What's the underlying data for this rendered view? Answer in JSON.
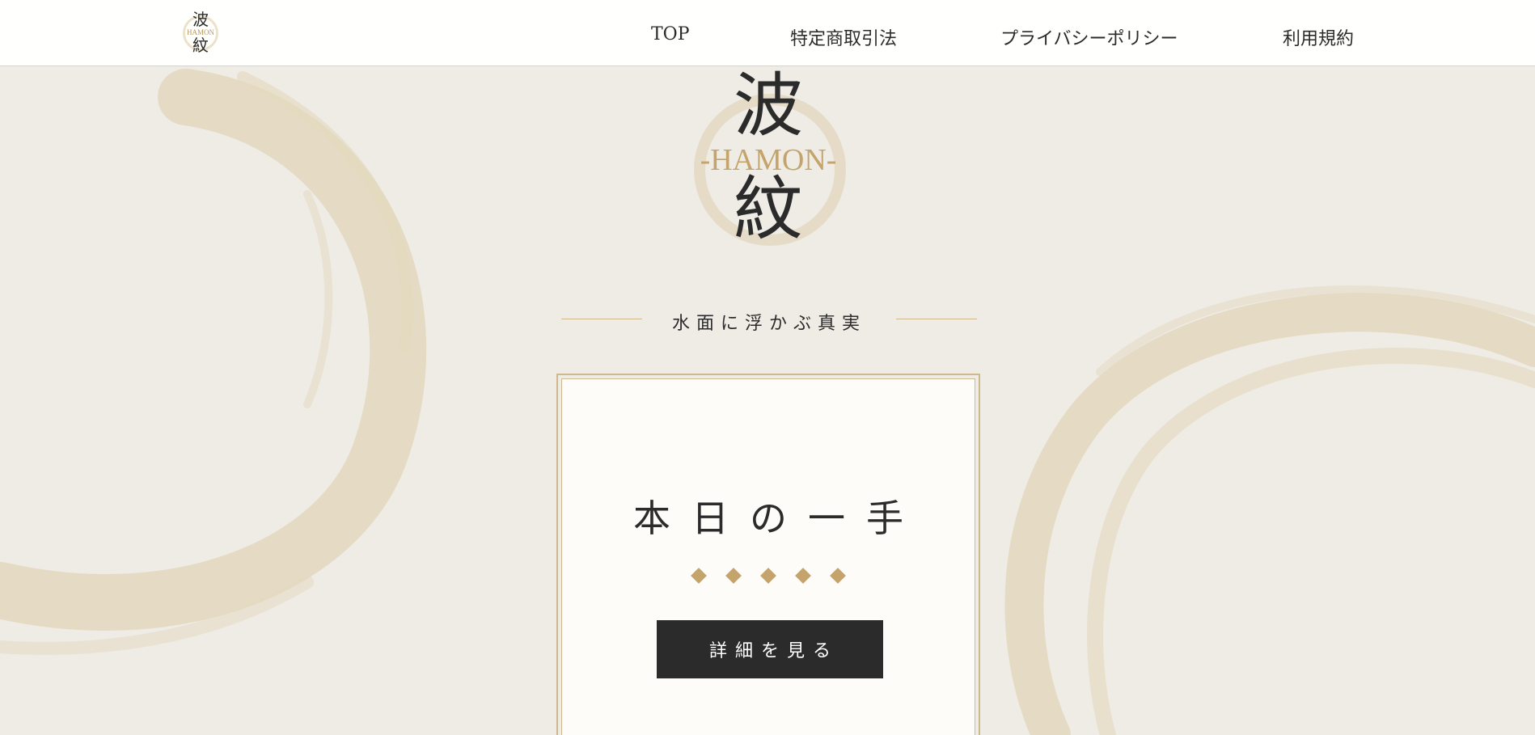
{
  "brand": {
    "kanji_top": "波",
    "kanji_bottom": "紋",
    "romaji": "-HAMON-",
    "header_romaji": "HAMON"
  },
  "nav": {
    "items": [
      {
        "label": "TOP"
      },
      {
        "label": "特定商取引法"
      },
      {
        "label": "プライバシーポリシー"
      },
      {
        "label": "利用規約"
      }
    ]
  },
  "hero": {
    "tagline": "水面に浮かぶ真実"
  },
  "card": {
    "title": "本日の一手",
    "rating": {
      "value": 5,
      "max": 5
    },
    "button_label": "詳細を見る"
  },
  "colors": {
    "background": "#efece6",
    "gold": "#c4a46a",
    "ink": "#2b2b2b",
    "card": "#fdfcf8"
  },
  "icons": [
    "ink-brush-circle-left",
    "ink-brush-circle-right",
    "diamond-icon"
  ]
}
